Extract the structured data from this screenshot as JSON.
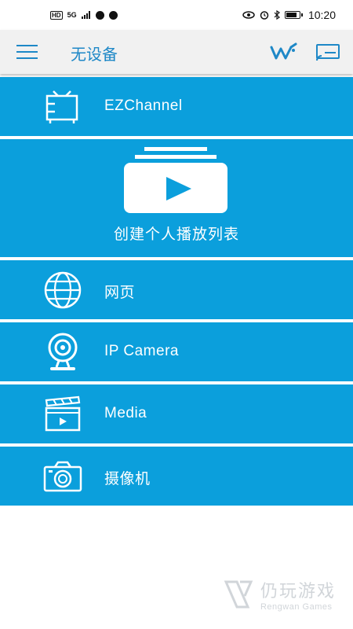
{
  "status_bar": {
    "left_badge": "HD",
    "network": "5G",
    "time": "10:20"
  },
  "app_bar": {
    "title": "无设备",
    "icons": [
      "menu-icon",
      "wifi-settings-icon",
      "cast-screen-icon"
    ]
  },
  "menu": {
    "items": [
      {
        "label": "EZChannel",
        "icon": "tv-icon"
      },
      {
        "label": "创建个人播放列表",
        "icon": "playlist-icon"
      },
      {
        "label": "网页",
        "icon": "globe-icon"
      },
      {
        "label": "IP Camera",
        "icon": "webcam-icon"
      },
      {
        "label": "Media",
        "icon": "clapperboard-icon"
      },
      {
        "label": "摄像机",
        "icon": "camera-icon"
      }
    ]
  },
  "watermark": {
    "main": "仍玩游戏",
    "sub": "Rengwan Games"
  },
  "colors": {
    "accent": "#1e88c7",
    "row_background": "#0b9fdc",
    "app_bar_background": "#f1f1f1"
  }
}
